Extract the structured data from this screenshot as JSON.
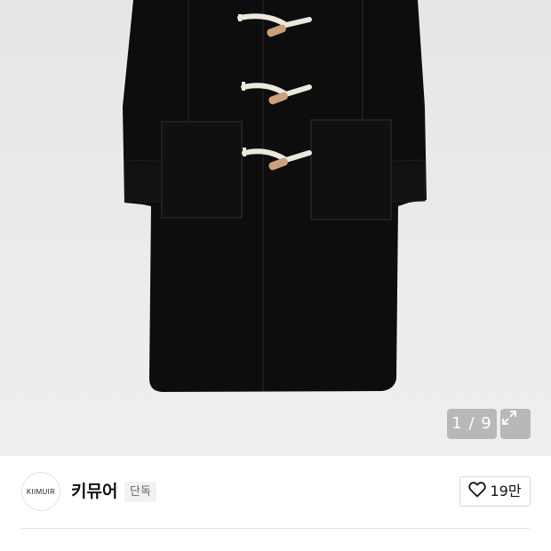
{
  "gallery": {
    "current_page": "1",
    "separator": "/",
    "total_pages": "9",
    "page_label": "1 / 9"
  },
  "brand": {
    "logo_text": "KIIMUIR",
    "name": "키뮤어",
    "badge": "단독"
  },
  "like": {
    "count_label": "19만"
  },
  "icons": {
    "expand": "expand-icon",
    "like": "heart-outline-icon"
  },
  "colors": {
    "coat": "#0c0c0c",
    "image_bg": "#e8e8e8",
    "overlay": "#8c8c8c"
  }
}
